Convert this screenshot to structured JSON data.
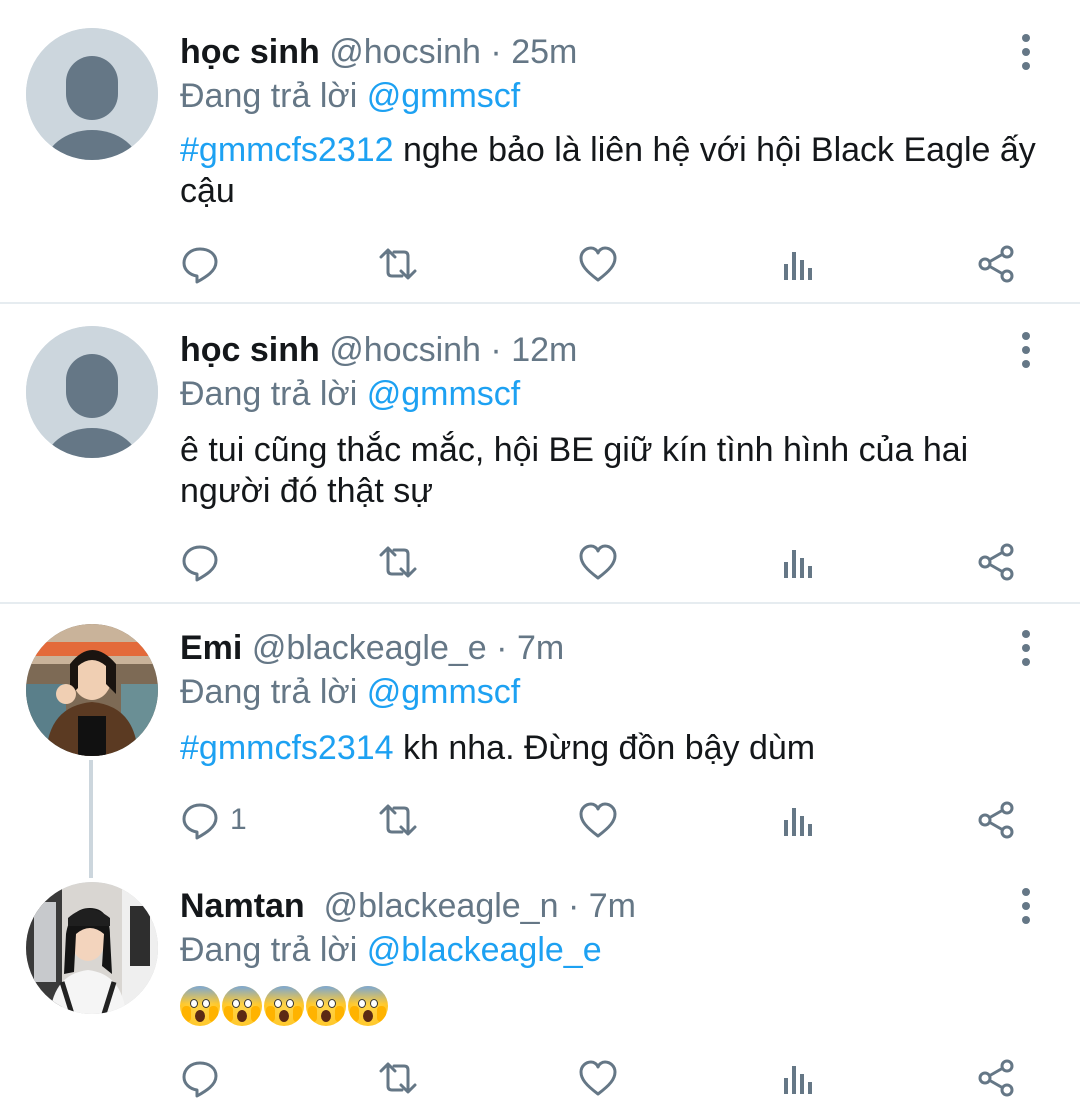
{
  "colors": {
    "link": "#1da1f2",
    "secondary_text": "#657786",
    "primary_text": "#14171a",
    "divider": "#e6ecf0",
    "default_avatar_bg": "#ccd6dd",
    "default_avatar_fg": "#657786"
  },
  "tweets": [
    {
      "name": "học sinh",
      "handle": "@hocsinh",
      "time": "· 25m",
      "replying_prefix": "Đang trả lời",
      "replying_to": "@gmmscf",
      "hashtag": "#gmmcfs2312",
      "text": " nghe bảo là liên hệ với hội Black Eagle ấy cậu",
      "avatar": "default-avatar-icon",
      "reply_count": ""
    },
    {
      "name": "học sinh",
      "handle": "@hocsinh",
      "time": "· 12m",
      "replying_prefix": "Đang trả lời",
      "replying_to": "@gmmscf",
      "hashtag": "",
      "text": "ê tui cũng thắc mắc, hội BE giữ kín tình hình của hai người đó thật sự",
      "avatar": "default-avatar-icon",
      "reply_count": ""
    },
    {
      "name": "Emi",
      "handle": "@blackeagle_e",
      "time": "· 7m",
      "replying_prefix": "Đang trả lời",
      "replying_to": "@gmmscf",
      "hashtag": "#gmmcfs2314",
      "text": " kh nha. Đừng đồn bậy dùm",
      "avatar": "photo-avatar",
      "reply_count": "1"
    },
    {
      "name": "Namtan",
      "handle": "@blackeagle_n",
      "time": "· 7m",
      "replying_prefix": "Đang trả lời",
      "replying_to": "@blackeagle_e",
      "hashtag": "",
      "text": "",
      "emojis": [
        "😱",
        "😱",
        "😱",
        "😱",
        "😱"
      ],
      "avatar": "photo-avatar",
      "reply_count": ""
    }
  ],
  "actions": [
    "reply-icon",
    "retweet-icon",
    "like-icon",
    "analytics-icon",
    "share-icon"
  ]
}
